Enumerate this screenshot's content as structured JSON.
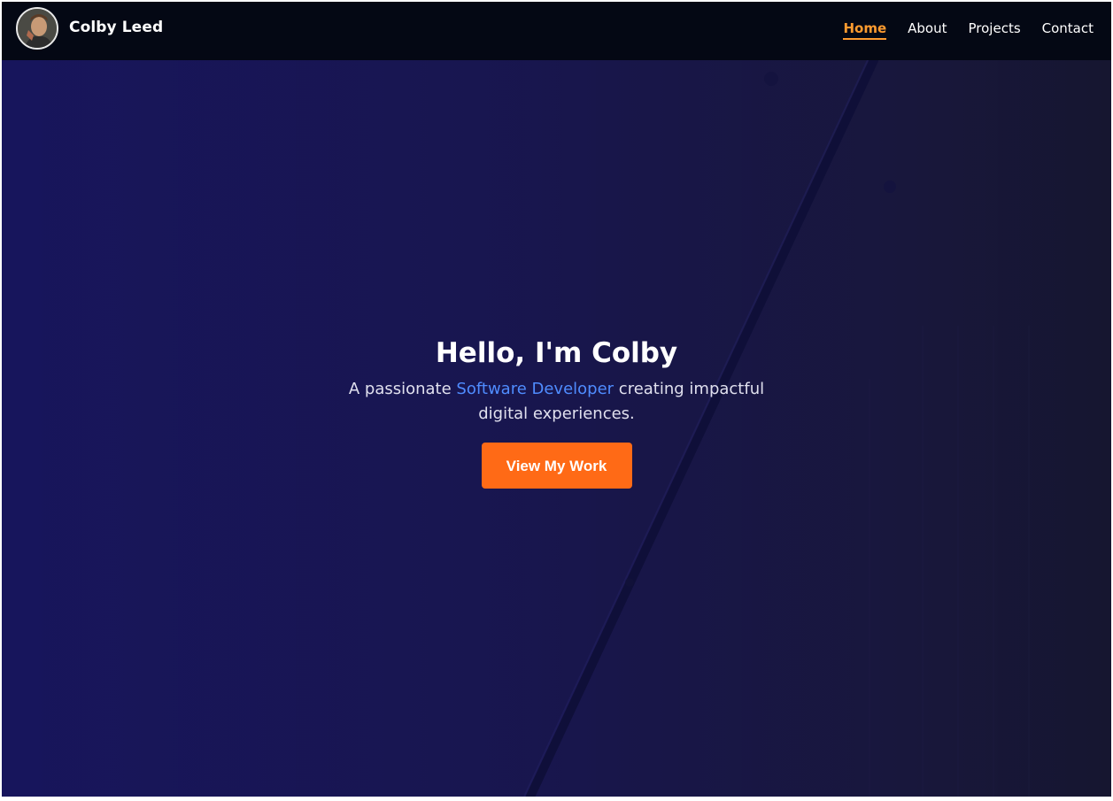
{
  "navbar": {
    "brand_name": "Colby Leed",
    "links": [
      {
        "label": "Home",
        "active": true
      },
      {
        "label": "About",
        "active": false
      },
      {
        "label": "Projects",
        "active": false
      },
      {
        "label": "Contact",
        "active": false
      }
    ],
    "active_color": "#ff9b2f",
    "background": "#040814"
  },
  "hero": {
    "title": "Hello, I'm Colby",
    "subtitle_prefix": "A passionate ",
    "subtitle_highlight": "Software Developer",
    "subtitle_suffix": " creating impactful digital experiences.",
    "cta_label": "View My Work",
    "cta_color": "#ff6a16",
    "highlight_color": "#4f8cff"
  }
}
